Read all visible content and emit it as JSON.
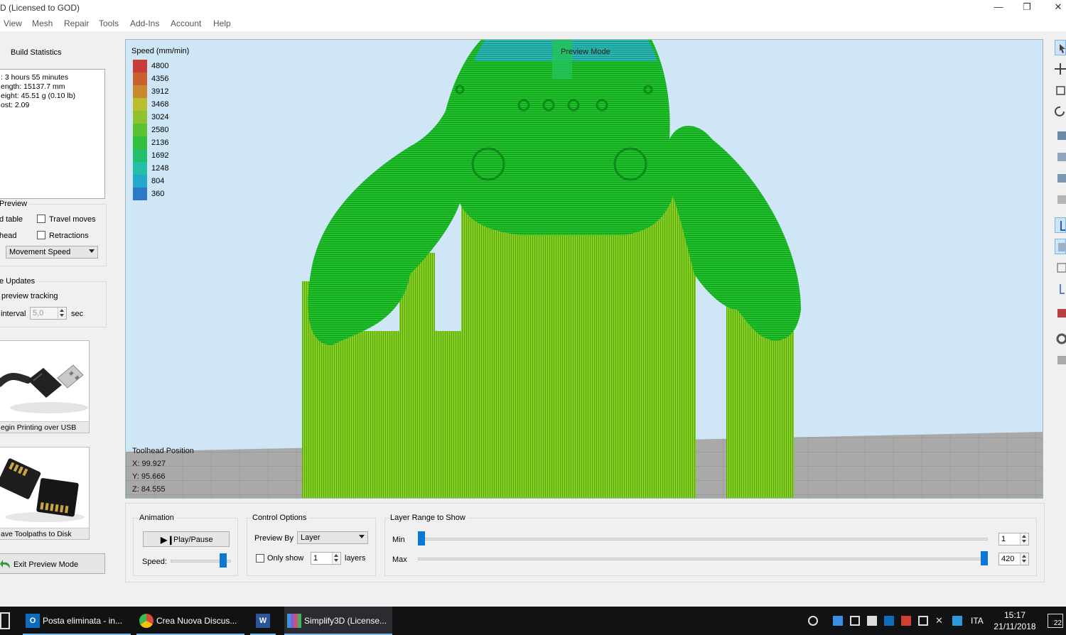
{
  "window": {
    "title": "D (Licensed to GOD)",
    "minimize_glyph": "—",
    "restore_glyph": "❐",
    "close_glyph": "✕"
  },
  "menu": [
    "View",
    "Mesh",
    "Repair",
    "Tools",
    "Add-Ins",
    "Account",
    "Help"
  ],
  "build_statistics": {
    "title": "Build Statistics",
    "lines": [
      ": 3 hours 55 minutes",
      "ength: 15137.7 mm",
      "eight: 45.51 g (0.10 lb)",
      "ost: 2.09"
    ]
  },
  "preview_group": {
    "title": "Preview",
    "left_labels": [
      "d table",
      "head"
    ],
    "travel_moves": {
      "label": "Travel moves",
      "checked": false
    },
    "retractions": {
      "label": "Retractions",
      "checked": false
    },
    "coloring": "Movement Speed"
  },
  "updates_group": {
    "title": "e Updates",
    "tracking_label": "preview tracking",
    "interval_label": "interval",
    "interval_value": "5,0",
    "interval_unit": "sec"
  },
  "tiles": {
    "usb_caption": "egin Printing over USB",
    "usb_icon": "usb-cable-icon",
    "sd_caption": "ave Toolpaths to Disk",
    "sd_icon": "sd-card-icon"
  },
  "exit_button": {
    "label": "Exit Preview Mode",
    "icon": "undo-arrow-icon"
  },
  "viewport": {
    "preview_mode_label": "Preview Mode",
    "speed_legend": {
      "title": "Speed (mm/min)",
      "entries": [
        {
          "value": "4800",
          "color": "#c93a3a"
        },
        {
          "value": "4356",
          "color": "#c9602e"
        },
        {
          "value": "3912",
          "color": "#c98a2e"
        },
        {
          "value": "3468",
          "color": "#b9bd2e"
        },
        {
          "value": "3024",
          "color": "#8fc131"
        },
        {
          "value": "2580",
          "color": "#5cc232"
        },
        {
          "value": "2136",
          "color": "#33bf3b"
        },
        {
          "value": "1692",
          "color": "#22bf6a"
        },
        {
          "value": "1248",
          "color": "#23bfa6"
        },
        {
          "value": "804",
          "color": "#23a9c9"
        },
        {
          "value": "360",
          "color": "#2d78c9"
        }
      ]
    },
    "toolhead": {
      "title": "Toolhead Position",
      "x": "X: 99.927",
      "y": "Y: 95.666",
      "z": "Z: 84.555"
    },
    "colors": {
      "sky": "#cfe6f6",
      "bed": "#a8a8a8",
      "model_green": "#1fbf2b",
      "support_green": "#7dcc1f",
      "top_cyan": "#2ab6b0"
    }
  },
  "animation": {
    "title": "Animation",
    "play_label": "Play/Pause",
    "play_icon": "play-pause-icon",
    "speed_label": "Speed:",
    "speed_level": 0.92
  },
  "control_options": {
    "title": "Control Options",
    "preview_by_label": "Preview By",
    "preview_by_value": "Layer",
    "only_show_label": "Only show",
    "only_show_checked": false,
    "only_show_value": "1",
    "layers_label": "layers"
  },
  "layer_range": {
    "title": "Layer Range to Show",
    "min_label": "Min",
    "max_label": "Max",
    "min_value": "1",
    "max_value": "420",
    "min_fraction": 0.0,
    "max_fraction": 1.0
  },
  "right_tools": [
    "select-icon",
    "move-icon",
    "scale-icon",
    "rotate-icon",
    "view-front-icon",
    "view-top-icon",
    "view-side-icon",
    "view-iso-icon",
    "axis-icon",
    "view-cube-icon",
    "wireframe-icon",
    "axes-icon",
    "section-icon",
    "gear-icon",
    "layers-icon"
  ],
  "taskbar": {
    "items": [
      {
        "label": "Posta eliminata - in...",
        "icon": "outlook-icon",
        "color": "#0f6cbd"
      },
      {
        "label": "Crea Nuova Discus...",
        "icon": "chrome-icon",
        "color": "#dd4b39"
      },
      {
        "label": "",
        "icon": "word-icon",
        "color": "#2b579a"
      },
      {
        "label": "Simplify3D (License...",
        "icon": "simplify3d-icon",
        "color": "#8a5cd0"
      }
    ],
    "language": "ITA",
    "time": "15:17",
    "date": "21/11/2018",
    "notifications": "22"
  }
}
